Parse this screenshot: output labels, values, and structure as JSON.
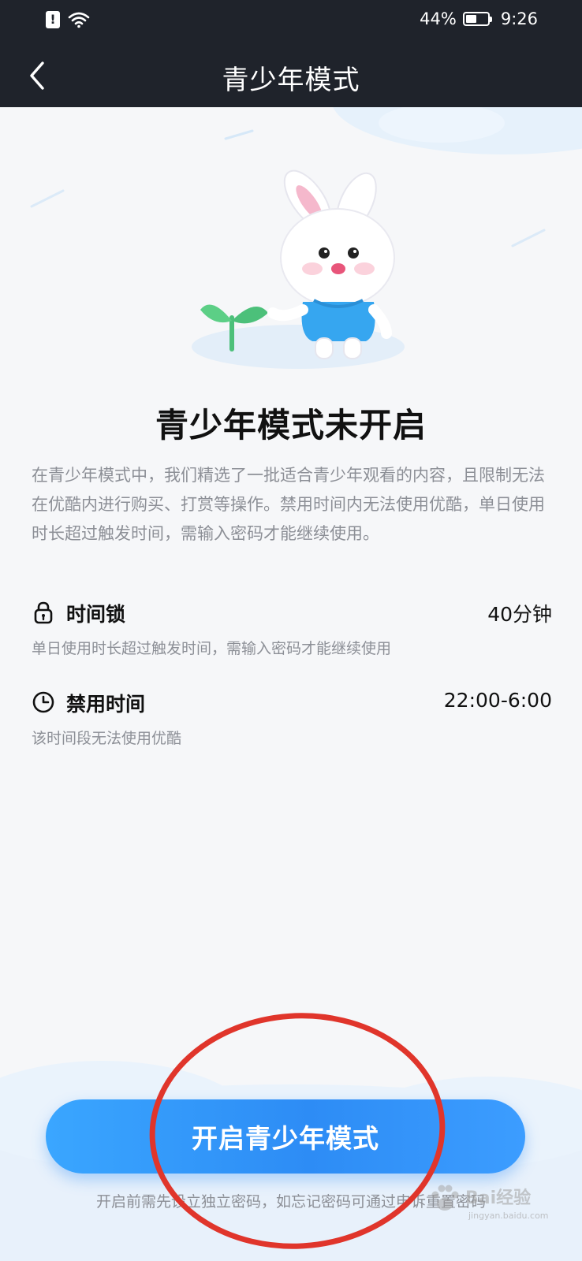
{
  "status_bar": {
    "battery": "44%",
    "time": "9:26"
  },
  "header": {
    "title": "青少年模式",
    "back_icon": "chevron-left-icon"
  },
  "hero": {
    "illustration": "bunny-mascot-with-sprout"
  },
  "main": {
    "title": "青少年模式未开启",
    "description": "在青少年模式中，我们精选了一批适合青少年观看的内容，且限制无法在优酷内进行购买、打赏等操作。禁用时间内无法使用优酷，单日使用时长超过触发时间，需输入密码才能继续使用。"
  },
  "settings": [
    {
      "icon": "lock-icon",
      "label": "时间锁",
      "value": "40分钟",
      "desc": "单日使用时长超过触发时间，需输入密码才能继续使用"
    },
    {
      "icon": "clock-icon",
      "label": "禁用时间",
      "value": "22:00-6:00",
      "desc": "该时间段无法使用优酷"
    }
  ],
  "bottom": {
    "button_label": "开启青少年模式",
    "footnote": "开启前需先设立独立密码，如忘记密码可通过申诉重置密码"
  },
  "watermark": {
    "text": "Bai经验",
    "sub": "jingyan.baidu.com"
  },
  "colors": {
    "header_bg": "#1f232b",
    "accent": "#2d8cf5",
    "annotation": "#e0352b"
  }
}
